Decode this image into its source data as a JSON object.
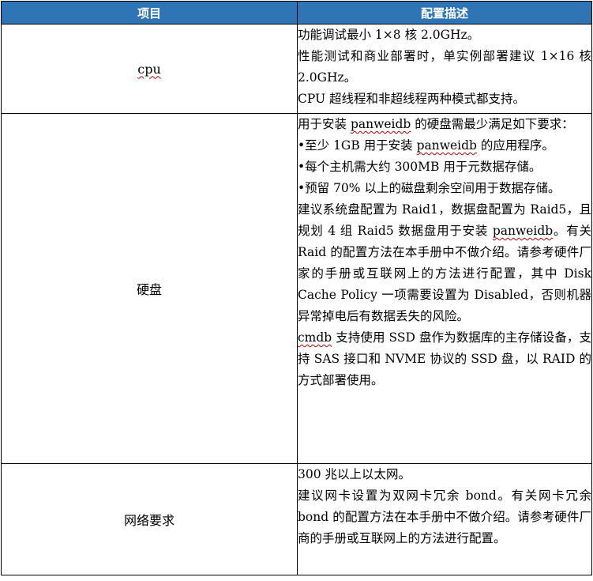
{
  "header": {
    "item": "项目",
    "desc": "配置描述"
  },
  "rows": [
    {
      "item": "cpu",
      "paragraphs": [
        "功能调试最小 1×8  核  2.0GHz。",
        "性能测试和商业部署时，单实例部署建议 1×16 核  2.0GHz。",
        "CPU 超线程和非超线程两种模式都支持。"
      ]
    },
    {
      "item": "硬盘",
      "p1_a": "用于安装 ",
      "p1_b": "panweidb",
      "p1_c": " 的硬盘需最少满足如下要求：",
      "p2_a": "•至少 1GB 用于安装 ",
      "p2_b": "panweidb",
      "p2_c": " 的应用程序。",
      "p3": "•每个主机需大约 300MB 用于元数据存储。",
      "p4": "•预留 70% 以上的磁盘剩余空间用于数据存储。",
      "p5_a": "建议系统盘配置为 Raid1，数据盘配置为 Raid5，且规划 4 组 Raid5 数据盘用于安装 ",
      "p5_b": "panweidb",
      "p5_c": "。有关 Raid 的配置方法在本手册中不做介绍。请参考硬件厂家的手册或互联网上的方法进行配置，其中 Disk Cache Policy 一项需要设置为 Disabled，否则机器异常掉电后有数据丢失的风险。",
      "p6_a": "cmdb",
      "p6_b": " 支持使用 SSD 盘作为数据库的主存储设备，支持 SAS 接口和 NVME 协议的 SSD 盘，以 RAID 的方式部署使用。"
    },
    {
      "item": "网络要求",
      "paragraphs": [
        "300 兆以上以太网。",
        "建议网卡设置为双网卡冗余 bond。有关网卡冗余 bond 的配置方法在本手册中不做介绍。请参考硬件厂商的手册或互联网上的方法进行配置。"
      ]
    }
  ],
  "colors": {
    "header_bg": "#2f75b5",
    "header_text": "#ffffff",
    "border": "#000000",
    "spellcheck": "#c00000"
  }
}
